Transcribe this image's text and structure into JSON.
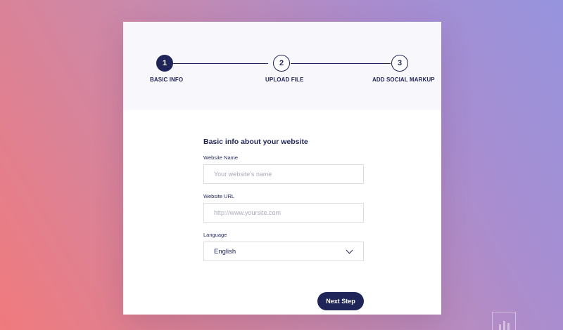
{
  "stepper": {
    "steps": [
      {
        "number": "1",
        "label": "BASIC INFO",
        "state": "active"
      },
      {
        "number": "2",
        "label": "UPLOAD FILE",
        "state": "inactive"
      },
      {
        "number": "3",
        "label": "ADD SOCIAL MARKUP",
        "state": "inactive"
      }
    ]
  },
  "form": {
    "title": "Basic info about your website",
    "website_name": {
      "label": "Website Name",
      "placeholder": "Your website's name",
      "value": ""
    },
    "website_url": {
      "label": "Website URL",
      "placeholder": "http://www.yoursite.com",
      "value": ""
    },
    "language": {
      "label": "Language",
      "value": "English"
    },
    "next_label": "Next Step"
  },
  "colors": {
    "accent": "#1f2559",
    "stepper_background": "#f8f7fb",
    "input_border": "#dcdde3",
    "placeholder": "#a9acbd"
  }
}
